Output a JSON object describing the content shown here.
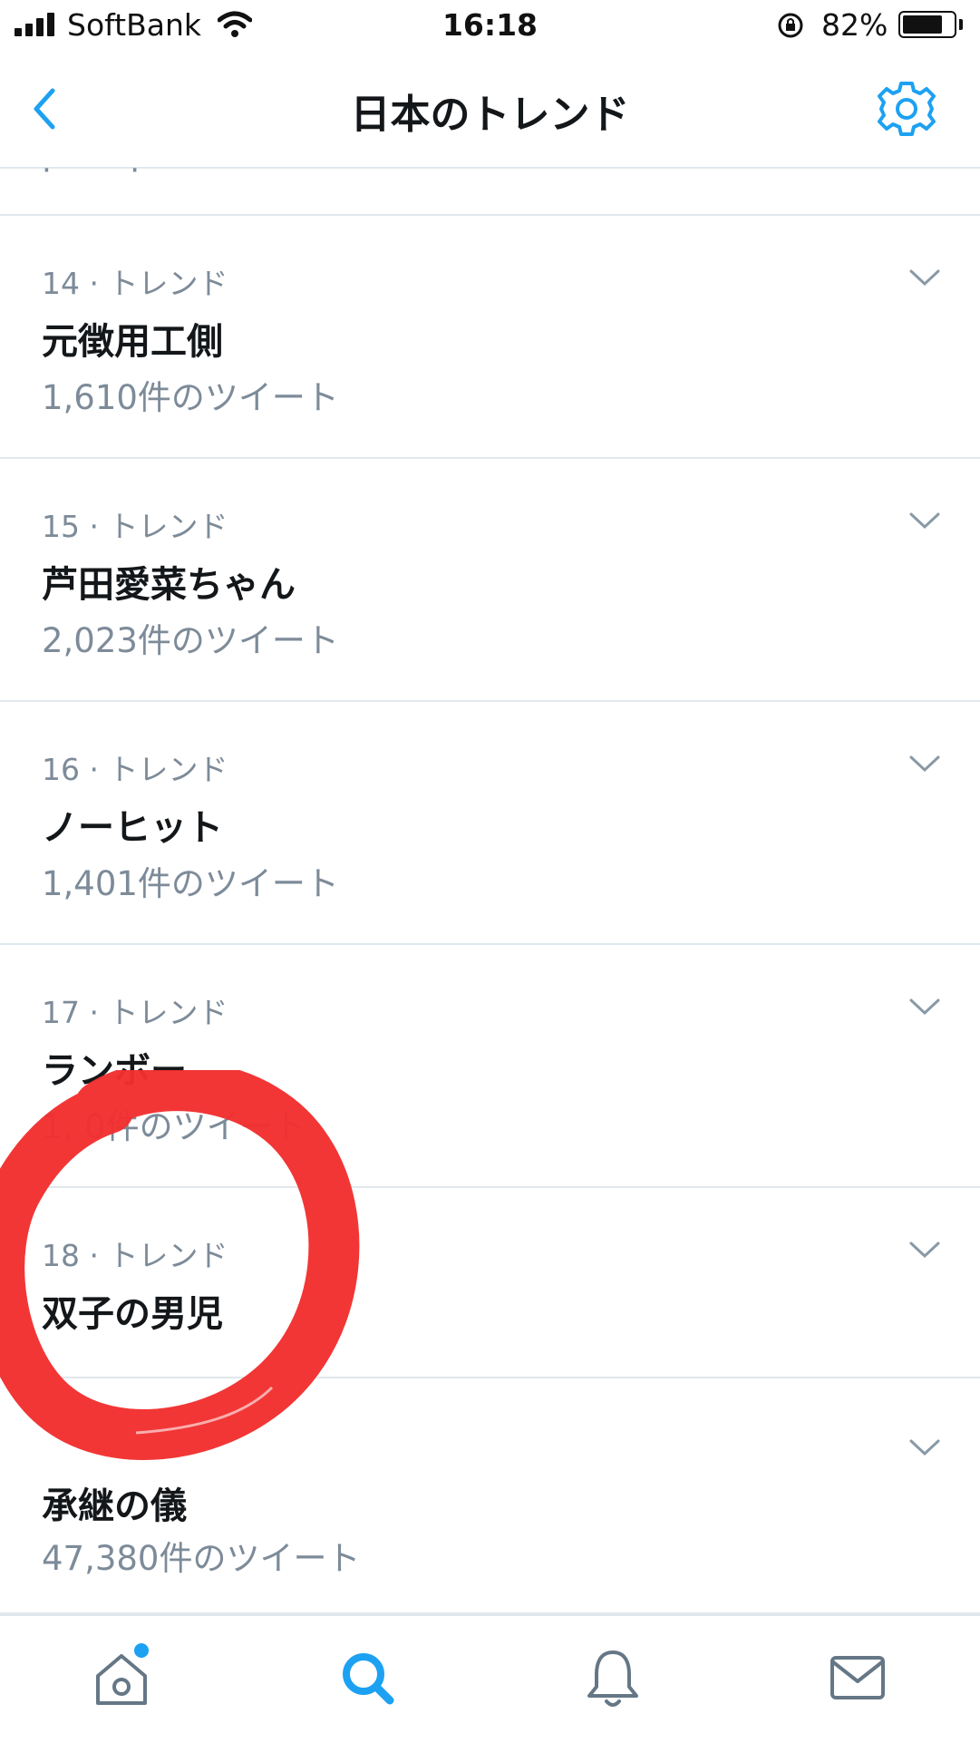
{
  "status_bar": {
    "carrier": "SoftBank",
    "time": "16:18",
    "battery_percent": "82%"
  },
  "nav": {
    "title": "日本のトレンド",
    "back_icon": "chevron-left-icon",
    "settings_icon": "gear-icon"
  },
  "trends": [
    {
      "meta": "14 · トレンド",
      "name": "元徴用工側",
      "count": "1,610件のツイート"
    },
    {
      "meta": "15 · トレンド",
      "name": "芦田愛菜ちゃん",
      "count": "2,023件のツイート"
    },
    {
      "meta": "16 · トレンド",
      "name": "ノーヒット",
      "count": "1,401件のツイート"
    },
    {
      "meta": "17 · トレンド",
      "name": "ランボー",
      "count": "1,   0件のツイート"
    },
    {
      "meta": "18 · トレンド",
      "name": "双子の男児",
      "count": ""
    },
    {
      "meta": "",
      "name": "承継の儀",
      "count": "47,380件のツイート"
    }
  ],
  "tab_bar": {
    "items": [
      "home-icon",
      "search-icon",
      "bell-icon",
      "mail-icon"
    ],
    "active": "search-icon",
    "home_has_notification_dot": true
  },
  "colors": {
    "accent": "#1da1f2",
    "muted_text": "#7d8b99",
    "divider": "#e1e8ed",
    "annotation": "#f2302f"
  }
}
